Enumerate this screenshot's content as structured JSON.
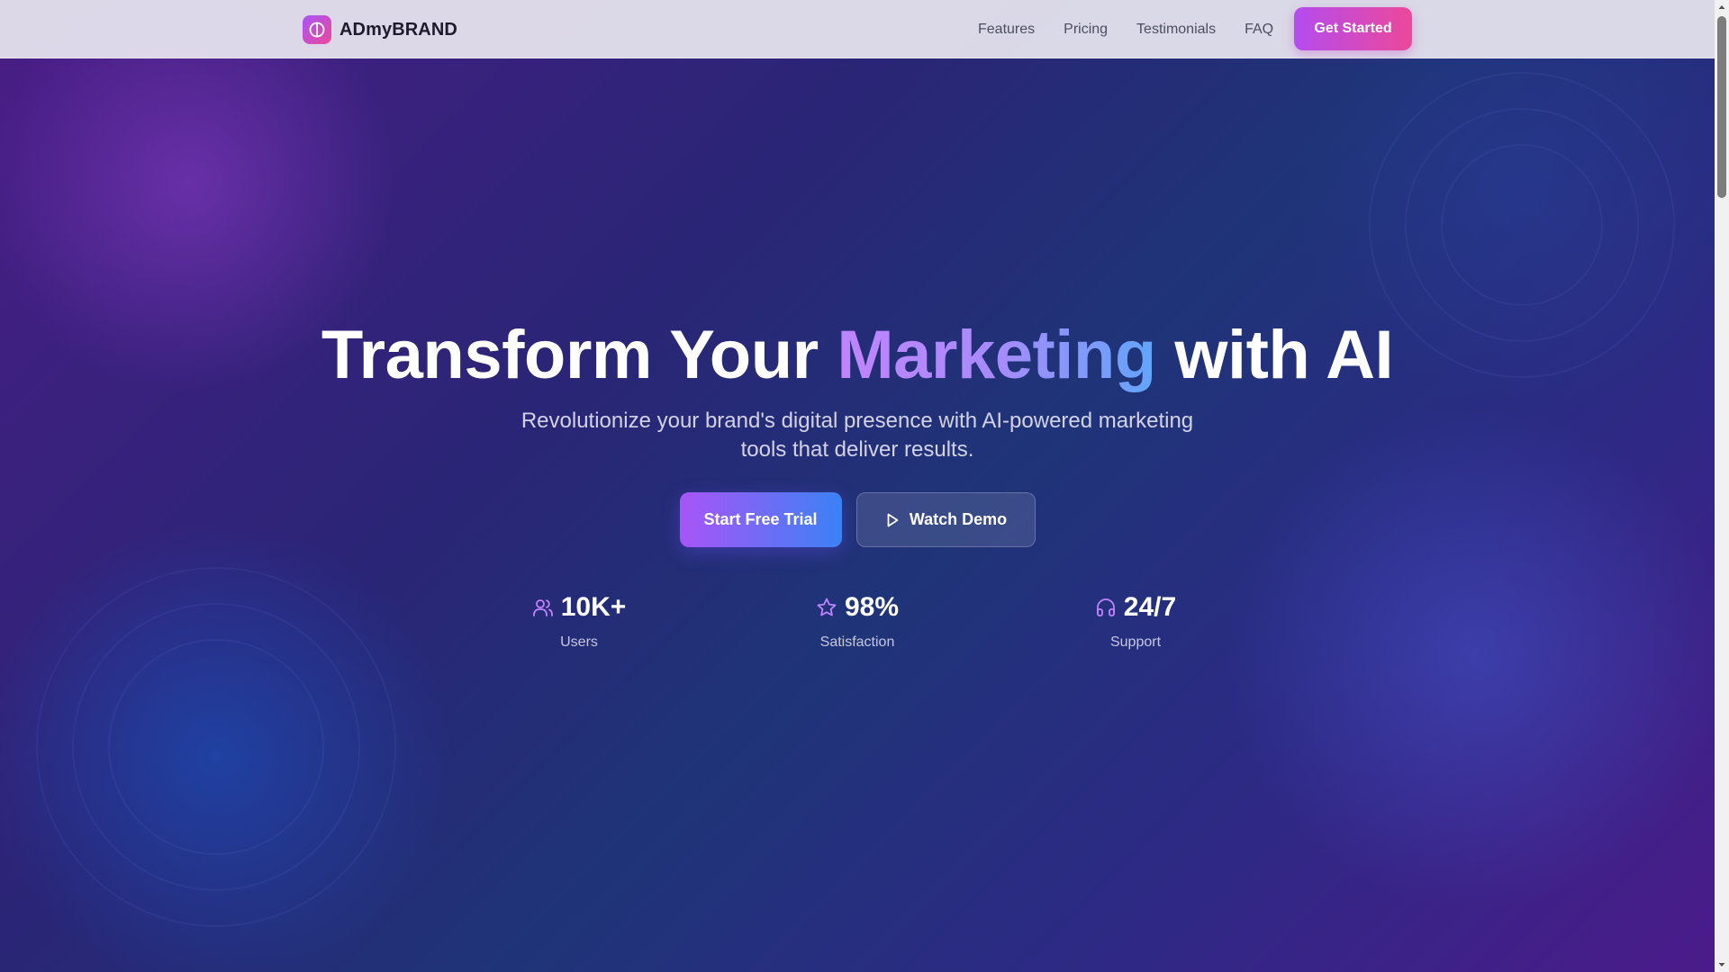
{
  "brand": {
    "name": "ADmyBRAND",
    "logo_icon": "brand-logo-icon"
  },
  "nav": {
    "links": [
      "Features",
      "Pricing",
      "Testimonials",
      "FAQ"
    ],
    "cta": "Get Started"
  },
  "hero": {
    "title_part1": "Transform Your ",
    "title_highlight": "Marketing",
    "title_part2": " with AI",
    "subtitle": "Revolutionize your brand's digital presence with AI-powered marketing tools that deliver results.",
    "primary_cta": "Start Free Trial",
    "secondary_cta": "Watch Demo"
  },
  "stats": [
    {
      "icon": "users-icon",
      "value": "10K+",
      "label": "Users"
    },
    {
      "icon": "star-icon",
      "value": "98%",
      "label": "Satisfaction"
    },
    {
      "icon": "headphones-icon",
      "value": "24/7",
      "label": "Support"
    }
  ],
  "colors": {
    "accent_purple": "#a855f7",
    "accent_pink": "#ec4899",
    "accent_blue": "#3b82f6",
    "background_dark": "#2a2576"
  }
}
